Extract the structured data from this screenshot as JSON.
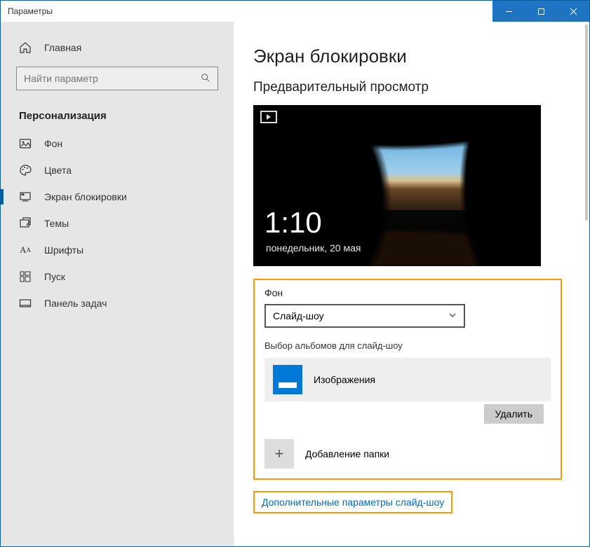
{
  "window": {
    "title": "Параметры"
  },
  "sidebar": {
    "home": "Главная",
    "search_placeholder": "Найти параметр",
    "section": "Персонализация",
    "items": [
      {
        "label": "Фон"
      },
      {
        "label": "Цвета"
      },
      {
        "label": "Экран блокировки"
      },
      {
        "label": "Темы"
      },
      {
        "label": "Шрифты"
      },
      {
        "label": "Пуск"
      },
      {
        "label": "Панель задач"
      }
    ]
  },
  "page": {
    "title": "Экран блокировки",
    "preview_heading": "Предварительный просмотр",
    "clock_time": "1:10",
    "clock_date": "понедельник, 20 мая",
    "bg_section_label": "Фон",
    "bg_dropdown_value": "Слайд-шоу",
    "albums_label": "Выбор альбомов для слайд-шоу",
    "album_name": "Изображения",
    "remove_btn": "Удалить",
    "add_folder": "Добавление папки",
    "advanced_link": "Дополнительные параметры слайд-шоу"
  }
}
